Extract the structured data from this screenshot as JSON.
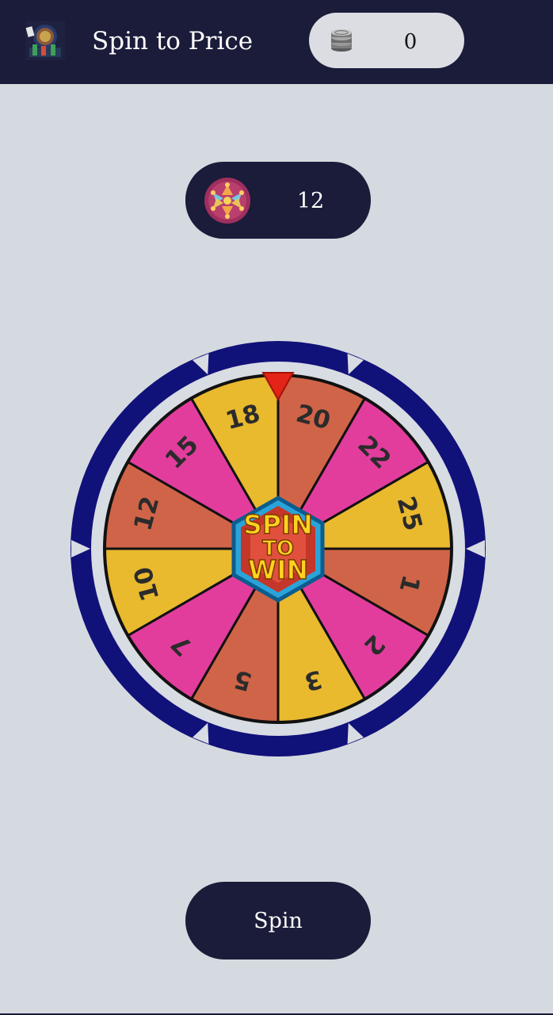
{
  "appbar": {
    "title": "Spin to Price",
    "logo_icon": "casino-chips-logo-icon",
    "coins": {
      "icon": "coin-stack-icon",
      "value": "0"
    }
  },
  "spins_left": {
    "icon": "prize-wheel-icon",
    "value": "12"
  },
  "wheel": {
    "pointer_icon": "red-triangle-pointer-icon",
    "center_badge": {
      "line1": "SPIN",
      "line2": "TO",
      "line3": "WIN"
    },
    "segments": [
      {
        "label": "20",
        "color": "#d06448"
      },
      {
        "label": "22",
        "color": "#e23d9d"
      },
      {
        "label": "25",
        "color": "#e9b92e"
      },
      {
        "label": "1",
        "color": "#d06448"
      },
      {
        "label": "2",
        "color": "#e23d9d"
      },
      {
        "label": "3",
        "color": "#e9b92e"
      },
      {
        "label": "5",
        "color": "#d06448"
      },
      {
        "label": "7",
        "color": "#e23d9d"
      },
      {
        "label": "10",
        "color": "#e9b92e"
      },
      {
        "label": "12",
        "color": "#d06448"
      },
      {
        "label": "15",
        "color": "#e23d9d"
      },
      {
        "label": "18",
        "color": "#e9b92e"
      }
    ],
    "rim_color": "#11117a"
  },
  "spin_button": {
    "label": "Spin"
  },
  "colors": {
    "navy": "#1b1b3a",
    "background": "#d5dae0"
  }
}
